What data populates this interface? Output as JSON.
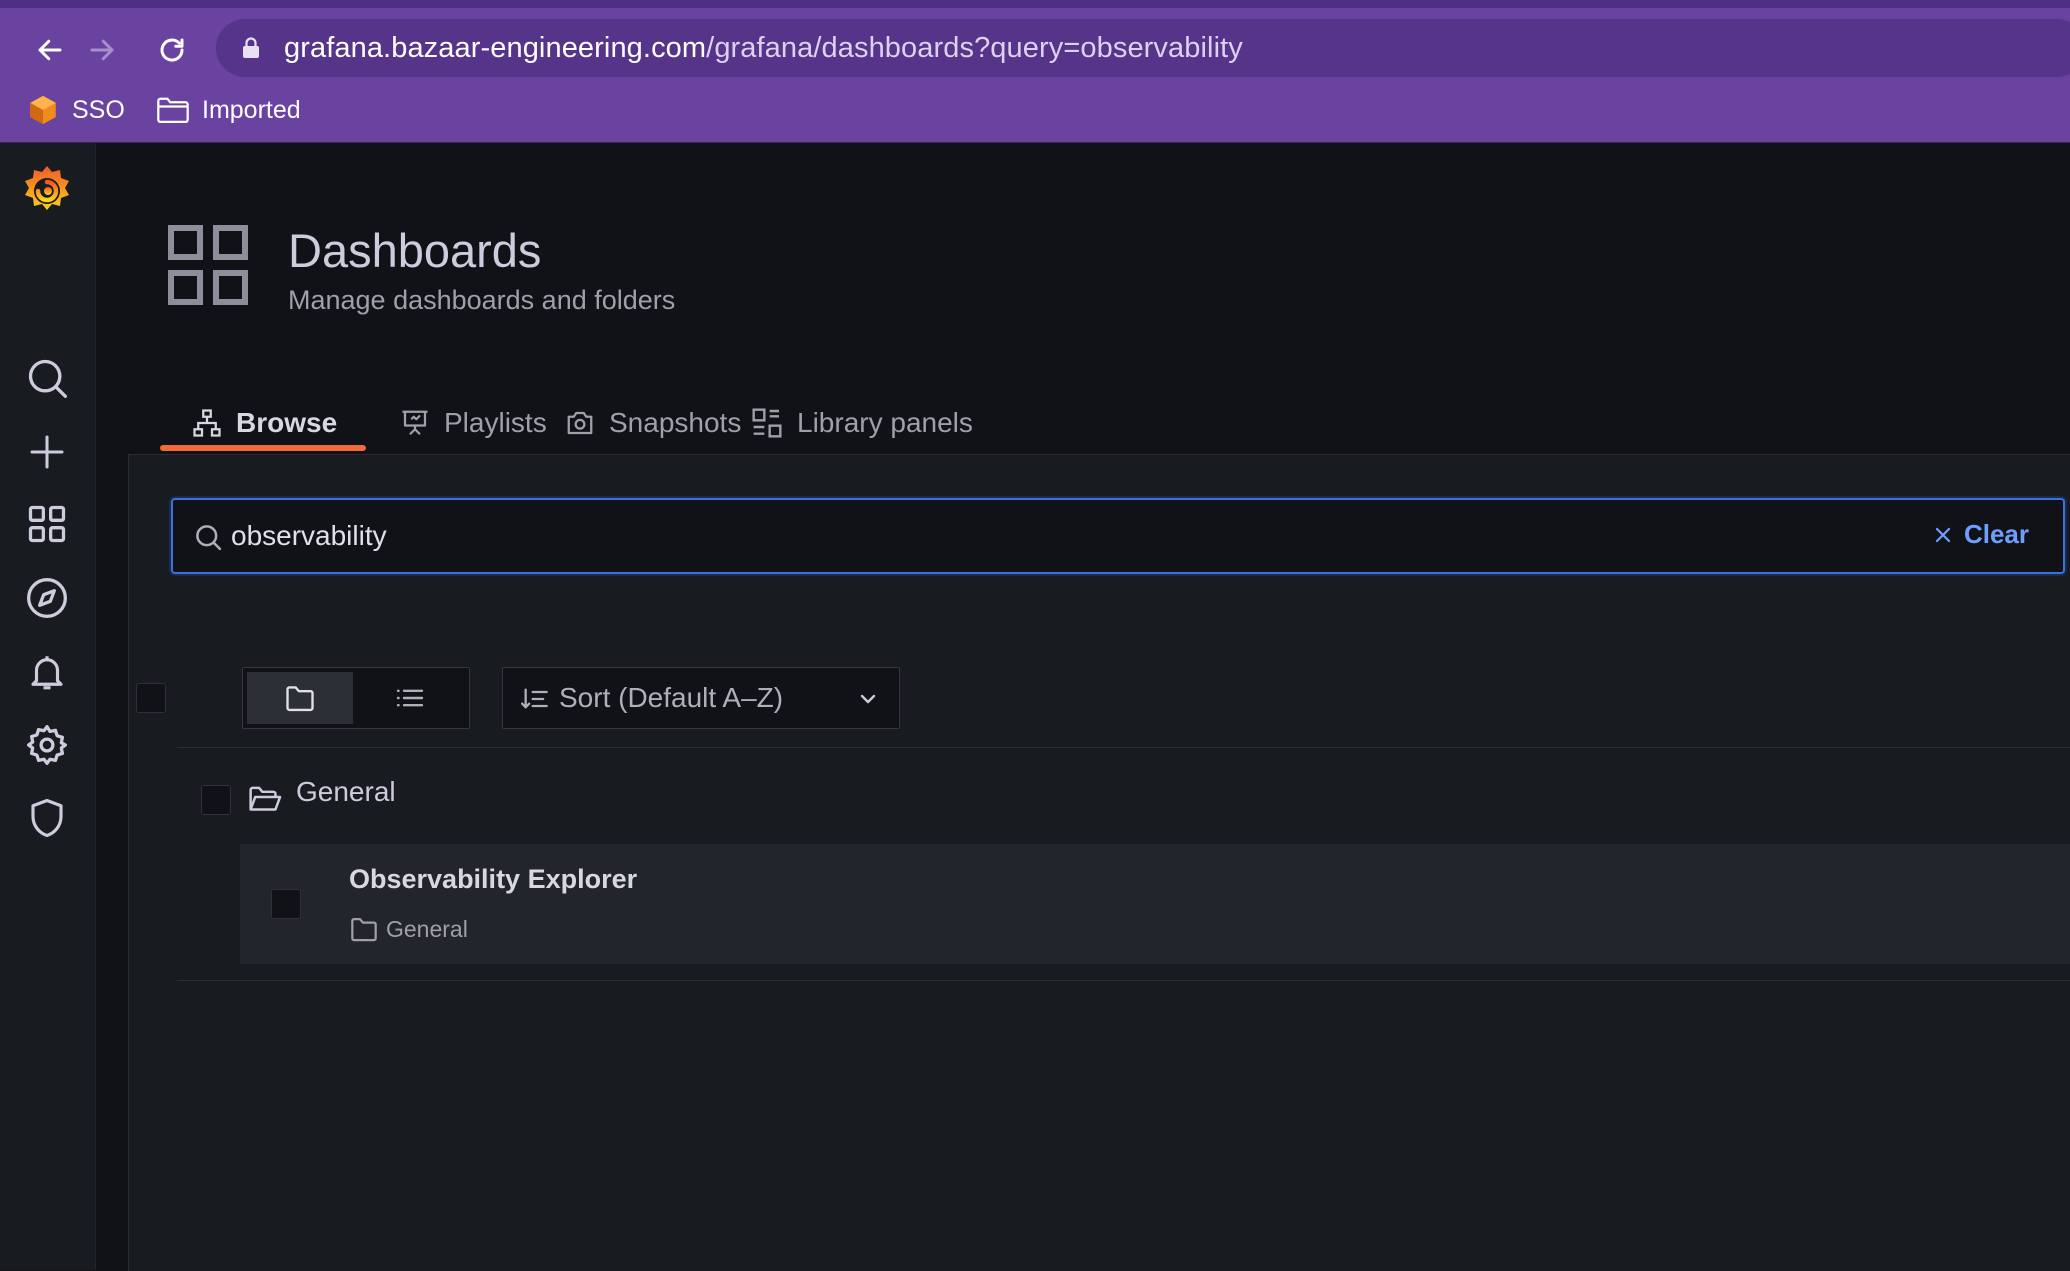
{
  "browser": {
    "url_host": "grafana.bazaar-engineering.com",
    "url_path": "/grafana/dashboards?query=observability",
    "bookmarks": [
      {
        "label": "SSO",
        "icon": "cube-icon"
      },
      {
        "label": "Imported",
        "icon": "folder-icon"
      }
    ]
  },
  "sidemenu": {
    "items": [
      "grafana-logo",
      "search-icon",
      "plus-icon",
      "dashboards-icon",
      "explore-compass-icon",
      "alert-bell-icon",
      "gear-icon",
      "shield-icon"
    ]
  },
  "page": {
    "title": "Dashboards",
    "subtitle": "Manage dashboards and folders"
  },
  "tabs": [
    {
      "label": "Browse",
      "icon": "sitemap-icon",
      "active": true
    },
    {
      "label": "Playlists",
      "icon": "presentation-icon",
      "active": false
    },
    {
      "label": "Snapshots",
      "icon": "camera-icon",
      "active": false
    },
    {
      "label": "Library panels",
      "icon": "library-panels-icon",
      "active": false
    }
  ],
  "search": {
    "value": "observability",
    "clear_label": "Clear"
  },
  "toolbar": {
    "sort_label": "Sort (Default A–Z)"
  },
  "results": {
    "folder_name": "General",
    "dashboards": [
      {
        "title": "Observability Explorer",
        "folder": "General"
      }
    ]
  },
  "colors": {
    "browser_chrome": "#6a42a0",
    "accent_tab": "#f06b37",
    "search_border": "#3d71d9",
    "clear_link": "#6e9fff"
  }
}
